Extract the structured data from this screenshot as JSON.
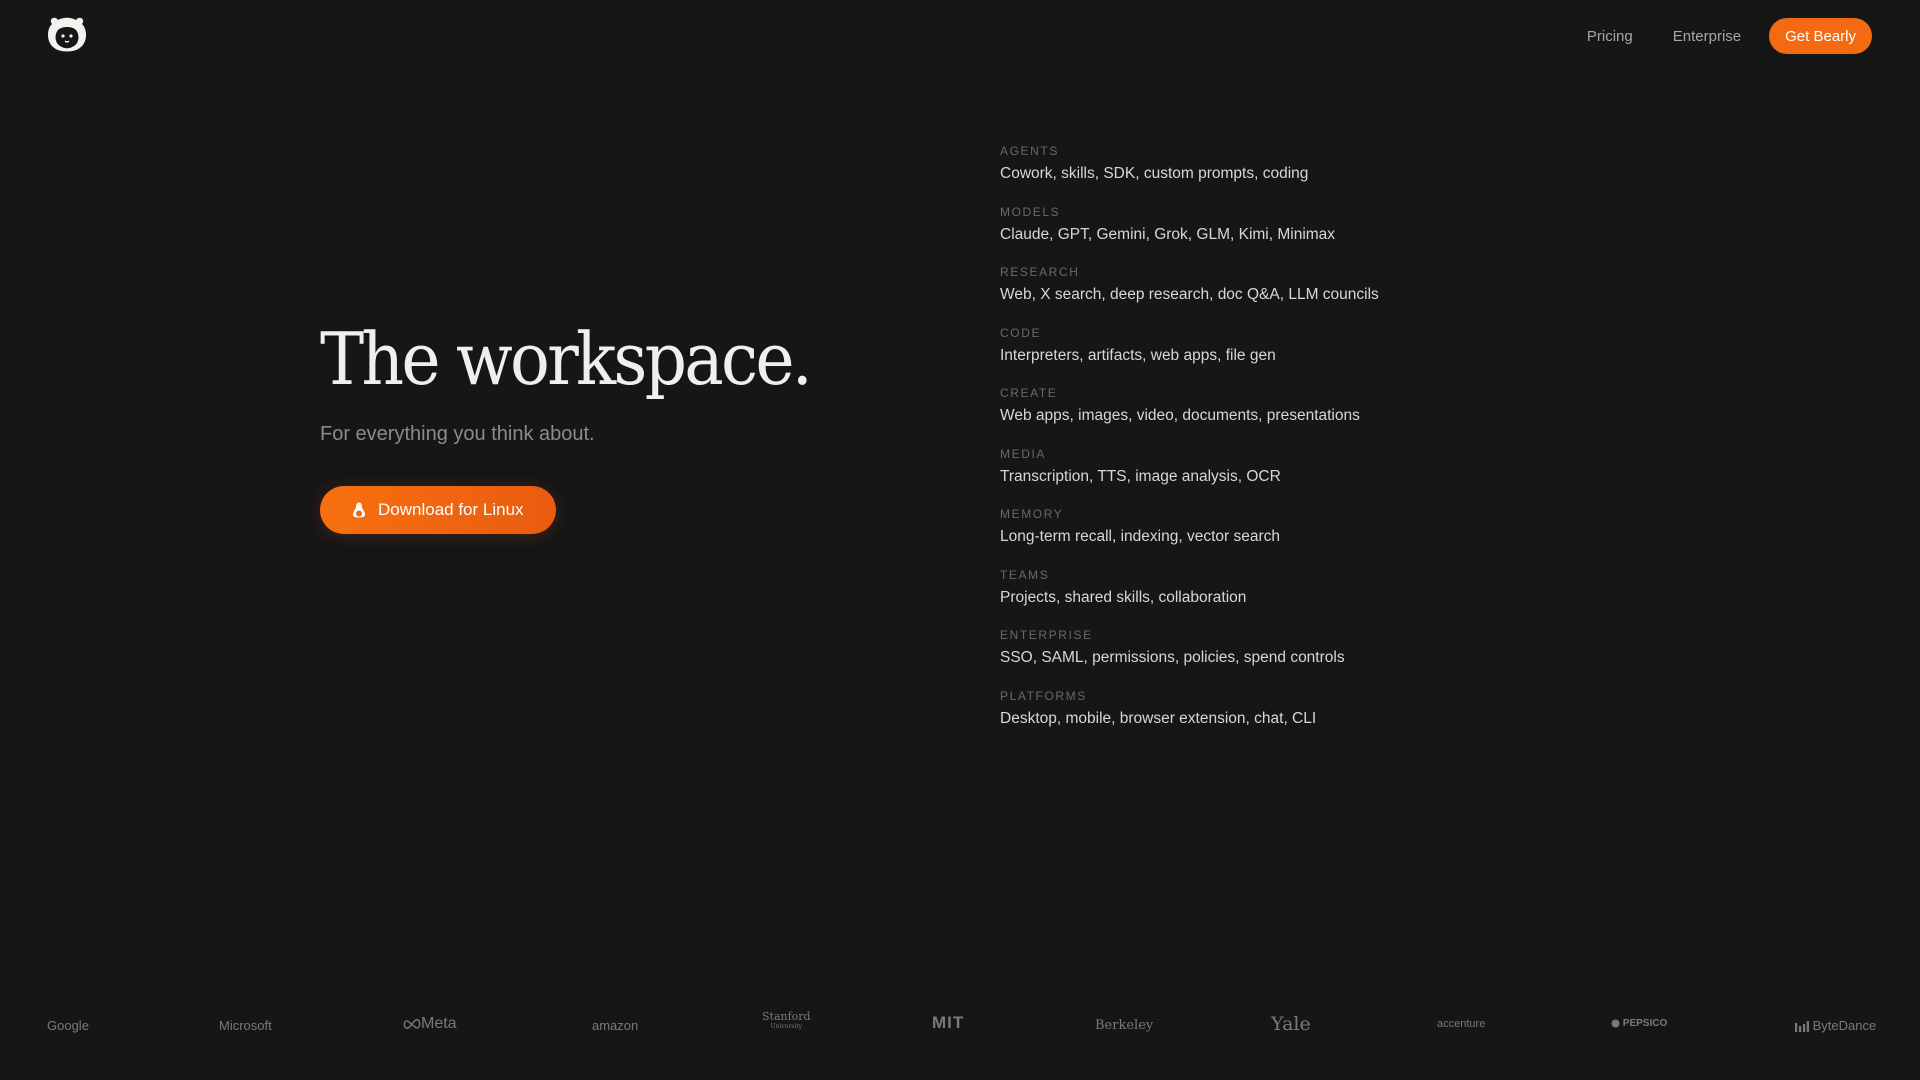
{
  "nav": {
    "logo_icon": "bear-logo-icon",
    "links": [
      {
        "label": "Pricing"
      },
      {
        "label": "Enterprise"
      }
    ],
    "cta_label": "Get Bearly"
  },
  "hero": {
    "title": "The workspace.",
    "subtitle": "For everything you think about.",
    "download_label": "Download for Linux",
    "download_icon": "linux-icon"
  },
  "features": [
    {
      "category": "AGENTS",
      "items": "Cowork, skills, SDK, custom prompts, coding"
    },
    {
      "category": "MODELS",
      "items": "Claude, GPT, Gemini, Grok, GLM, Kimi, Minimax"
    },
    {
      "category": "RESEARCH",
      "items": "Web, X search, deep research, doc Q&A, LLM councils"
    },
    {
      "category": "CODE",
      "items": "Interpreters, artifacts, web apps, file gen"
    },
    {
      "category": "CREATE",
      "items": "Web apps, images, video, documents, presentations"
    },
    {
      "category": "MEDIA",
      "items": "Transcription, TTS, image analysis, OCR"
    },
    {
      "category": "MEMORY",
      "items": "Long-term recall, indexing, vector search"
    },
    {
      "category": "TEAMS",
      "items": "Projects, shared skills, collaboration"
    },
    {
      "category": "ENTERPRISE",
      "items": "SSO, SAML, permissions, policies, spend controls"
    },
    {
      "category": "PLATFORMS",
      "items": "Desktop, mobile, browser extension, chat, CLI"
    }
  ],
  "logos": {
    "google": "Google",
    "microsoft": "Microsoft",
    "meta": "Meta",
    "amazon": "amazon",
    "stanford": "Stanford",
    "stanford_sub": "University",
    "mit": "MIT",
    "berkeley": "Berkeley",
    "yale": "Yale",
    "accenture": "accenture",
    "pepsico": "PEPSICO",
    "bytedance": "ByteDance"
  },
  "colors": {
    "background": "#161617",
    "accent": "#f36a12"
  }
}
